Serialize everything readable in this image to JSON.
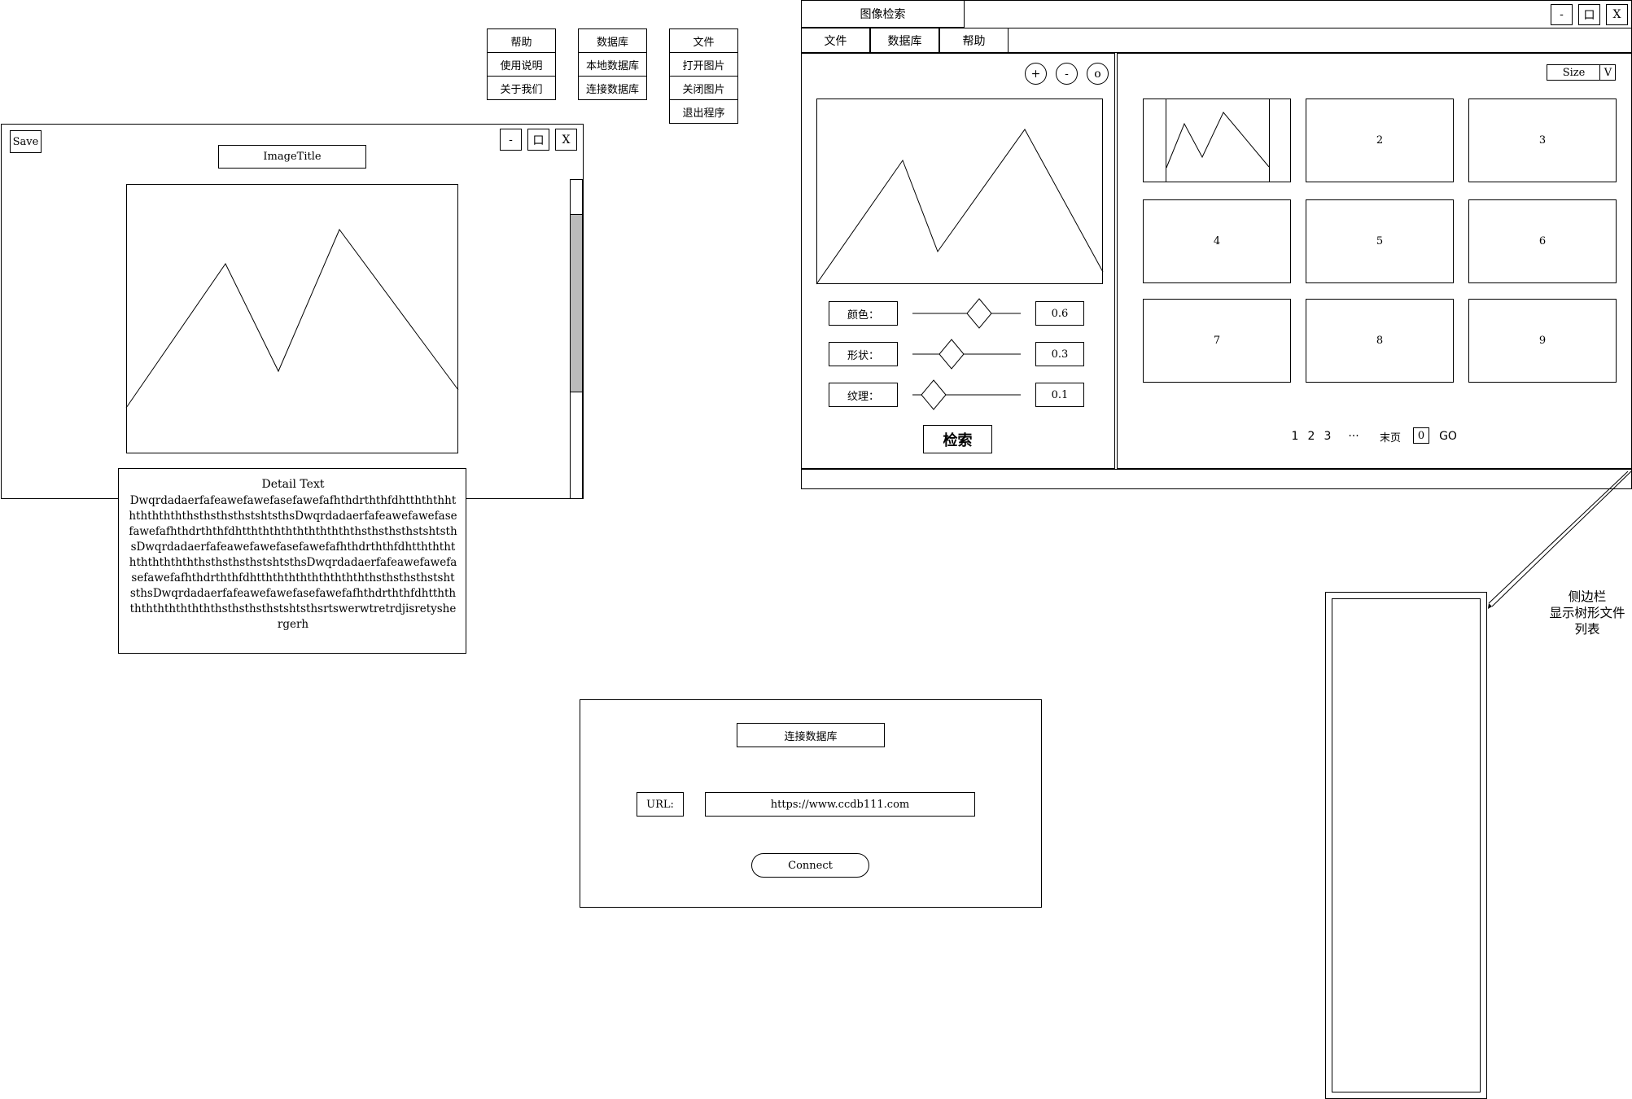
{
  "menus": {
    "help": {
      "title": "帮助",
      "items": [
        "使用说明",
        "关于我们"
      ]
    },
    "database": {
      "title": "数据库",
      "items": [
        "本地数据库",
        "连接数据库"
      ]
    },
    "file": {
      "title": "文件",
      "items": [
        "打开图片",
        "关闭图片",
        "退出程序"
      ]
    }
  },
  "viewer": {
    "save_label": "Save",
    "image_title": "ImageTitle",
    "minimize": "-",
    "maximize": "口",
    "close": "X",
    "detail_title": "Detail Text",
    "detail_text": "DwqrdadaerfafeawefawefasefawefafhthdrththfdhtthththhththththththsthsthsthstshtsthsDwqrdadaerfafeawefawefasefawefafhthdrththfdhtththththththththththsthsthsthstshtsthsDwqrdadaerfafeawefawefasefawefafhthdrththfdhtththththththththththsthsthsthstshtsthsDwqrdadaerfafeawefawefasefawefafhthdrththfdhtththththththththththsthsthsthstshtsthsDwqrdadaerfafeawefawefasefawefafhthdrththfdhtththththththththththsthsthsthstshtsthsrtswerwtretrdjisretyshergerh"
  },
  "main_window": {
    "title": "图像检索",
    "minimize": "-",
    "maximize": "口",
    "close": "X",
    "menu": [
      "文件",
      "数据库",
      "帮助"
    ],
    "zoom_in": "+",
    "zoom_out": "-",
    "reset": "o",
    "features": [
      {
        "label": "颜色：",
        "value": "0.6"
      },
      {
        "label": "形状：",
        "value": "0.3"
      },
      {
        "label": "纹理：",
        "value": "0.1"
      }
    ],
    "search_button": "检索",
    "size_label": "Size",
    "size_dropdown": "V",
    "thumbnails": [
      "2",
      "3",
      "4",
      "5",
      "6",
      "7",
      "8",
      "9"
    ],
    "pagination": {
      "pages": [
        "1",
        "2",
        "3"
      ],
      "ellipsis": "···",
      "last": "末页",
      "input": "0",
      "go": "GO"
    }
  },
  "sidebar_note": {
    "line1": "侧边栏",
    "line2": "显示树形文件",
    "line3": "列表"
  },
  "connect_dialog": {
    "title": "连接数据库",
    "url_label": "URL:",
    "url_value": "https://www.ccdb111.com",
    "connect_button": "Connect"
  }
}
